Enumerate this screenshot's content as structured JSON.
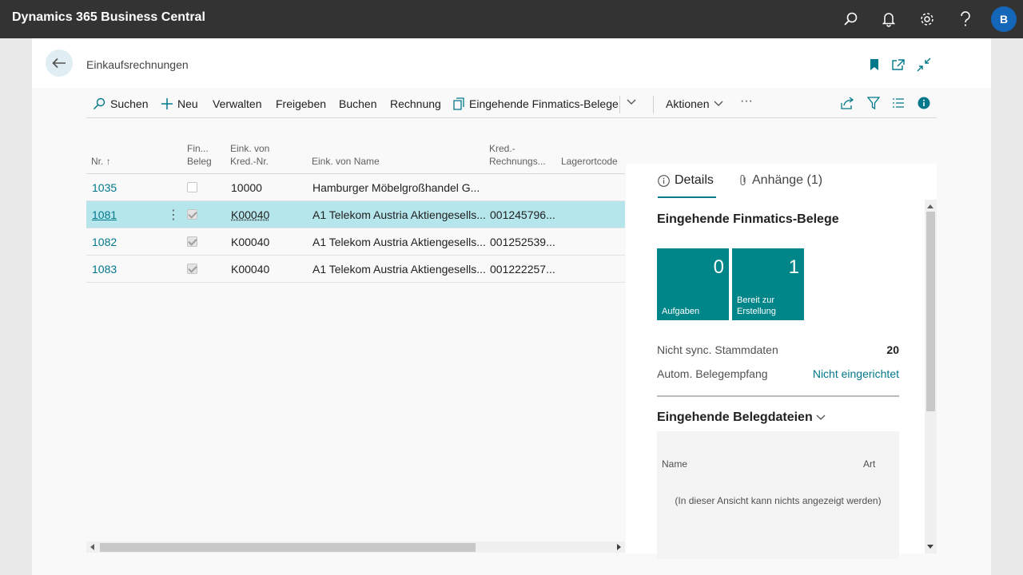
{
  "app": {
    "title": "Dynamics 365 Business Central",
    "user_initial": "B"
  },
  "page": {
    "title": "Einkaufsrechnungen"
  },
  "actions": {
    "search": "Suchen",
    "new": "Neu",
    "manage": "Verwalten",
    "release": "Freigeben",
    "post": "Buchen",
    "invoice": "Rechnung",
    "finmatics": "Eingehende Finmatics-Belege",
    "actions": "Aktionen",
    "more": "···"
  },
  "columns": {
    "nr": "Nr.",
    "fin_line1": "Fin...",
    "fin_line2": "Beleg",
    "vendor_nr_line1": "Eink. von",
    "vendor_nr_line2": "Kred.-Nr.",
    "vendor_name": "Eink. von Name",
    "invoice_nr_line1": "Kred.-",
    "invoice_nr_line2": "Rechnungs...",
    "location": "Lagerortcode"
  },
  "rows": [
    {
      "nr": "1035",
      "fin_beleg": false,
      "vendor_nr": "10000",
      "vendor_name": "Hamburger Möbelgroßhandel G...",
      "invoice_nr": ""
    },
    {
      "nr": "1081",
      "fin_beleg": true,
      "vendor_nr": "K00040",
      "vendor_name": "A1 Telekom Austria Aktiengesells...",
      "invoice_nr": "001245796..."
    },
    {
      "nr": "1082",
      "fin_beleg": true,
      "vendor_nr": "K00040",
      "vendor_name": "A1 Telekom Austria Aktiengesells...",
      "invoice_nr": "001252539..."
    },
    {
      "nr": "1083",
      "fin_beleg": true,
      "vendor_nr": "K00040",
      "vendor_name": "A1 Telekom Austria Aktiengesells...",
      "invoice_nr": "001222257..."
    }
  ],
  "factbox": {
    "tab_details": "Details",
    "tab_attachments": "Anhänge (1)",
    "section_title": "Eingehende Finmatics-Belege",
    "tiles": [
      {
        "value": "0",
        "label": "Aufgaben"
      },
      {
        "value": "1",
        "label_line1": "Bereit zur",
        "label_line2": "Erstellung"
      }
    ],
    "unsynced_label": "Nicht sync. Stammdaten",
    "unsynced_value": "20",
    "auto_label": "Autom. Belegempfang",
    "auto_value": "Nicht eingerichtet",
    "files_title": "Eingehende Belegdateien",
    "files_col_name": "Name",
    "files_col_type": "Art",
    "files_empty": "(In dieser Ansicht kann nichts angezeigt werden)"
  },
  "colors": {
    "accent": "#00788a",
    "tile": "#008589",
    "topbar": "#333333",
    "selected_row": "#b5e6ec"
  }
}
